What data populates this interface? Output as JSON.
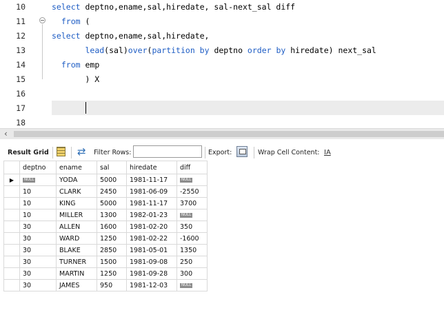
{
  "editor": {
    "line_numbers": [
      "10",
      "11",
      "12",
      "13",
      "14",
      "15",
      "16",
      "17",
      "18"
    ],
    "lines": [
      [
        {
          "t": "select",
          "k": "kw"
        },
        {
          "t": " deptno,ename,sal,hiredate, sal-next_sal diff"
        }
      ],
      [
        {
          "t": "  "
        },
        {
          "t": "from",
          "k": "kw"
        },
        {
          "t": " ("
        }
      ],
      [
        {
          "t": "select",
          "k": "kw"
        },
        {
          "t": " deptno,ename,sal,hiredate,"
        }
      ],
      [
        {
          "t": "       "
        },
        {
          "t": "lead",
          "k": "fn"
        },
        {
          "t": "(sal)"
        },
        {
          "t": "over",
          "k": "kw"
        },
        {
          "t": "("
        },
        {
          "t": "partition by",
          "k": "kw"
        },
        {
          "t": " deptno "
        },
        {
          "t": "order by",
          "k": "kw"
        },
        {
          "t": " hiredate) next_sal"
        }
      ],
      [
        {
          "t": "  "
        },
        {
          "t": "from",
          "k": "kw"
        },
        {
          "t": " emp"
        }
      ],
      [
        {
          "t": "       ) X"
        }
      ],
      [],
      [],
      []
    ]
  },
  "toolbar": {
    "result_grid_label": "Result Grid",
    "filter_rows_label": "Filter Rows:",
    "filter_value": "",
    "export_label": "Export:",
    "wrap_label": "Wrap Cell Content:",
    "wrap_icon": "IA"
  },
  "grid": {
    "columns": [
      "deptno",
      "ename",
      "sal",
      "hiredate",
      "diff"
    ],
    "null_label": "NULL",
    "rows": [
      [
        null,
        "YODA",
        "5000",
        "1981-11-17",
        null
      ],
      [
        "10",
        "CLARK",
        "2450",
        "1981-06-09",
        "-2550"
      ],
      [
        "10",
        "KING",
        "5000",
        "1981-11-17",
        "3700"
      ],
      [
        "10",
        "MILLER",
        "1300",
        "1982-01-23",
        null
      ],
      [
        "30",
        "ALLEN",
        "1600",
        "1981-02-20",
        "350"
      ],
      [
        "30",
        "WARD",
        "1250",
        "1981-02-22",
        "-1600"
      ],
      [
        "30",
        "BLAKE",
        "2850",
        "1981-05-01",
        "1350"
      ],
      [
        "30",
        "TURNER",
        "1500",
        "1981-09-08",
        "250"
      ],
      [
        "30",
        "MARTIN",
        "1250",
        "1981-09-28",
        "300"
      ],
      [
        "30",
        "JAMES",
        "950",
        "1981-12-03",
        null
      ]
    ],
    "selected_row_marker": "▶"
  },
  "colors": {
    "keyword": "#1d5cc4",
    "current_line": "#ececec"
  }
}
